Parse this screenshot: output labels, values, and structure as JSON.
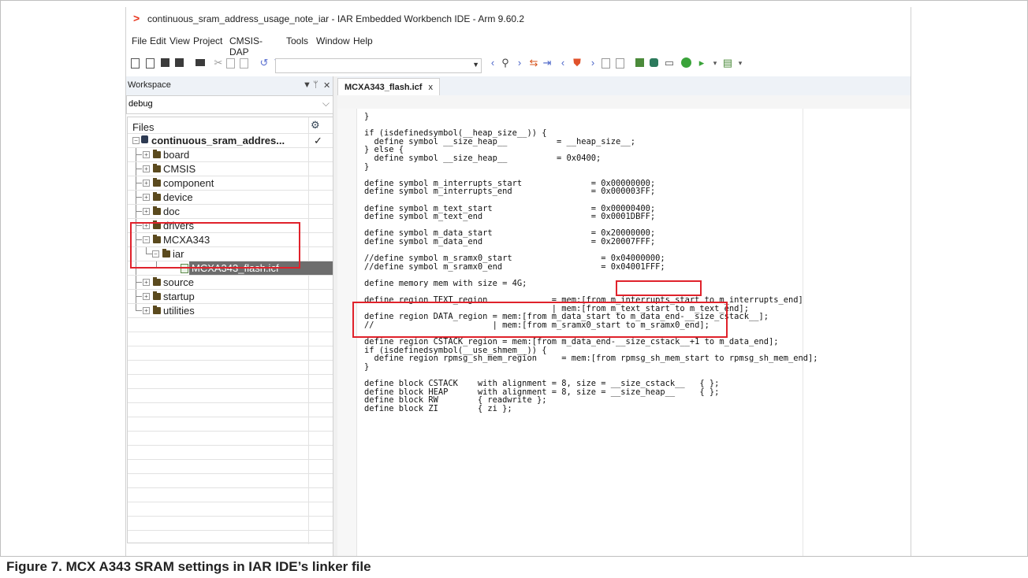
{
  "window": {
    "title": "continuous_sram_address_usage_note_iar - IAR Embedded Workbench IDE - Arm 9.60.2",
    "logo_glyph": ">"
  },
  "menu": [
    "File",
    "Edit",
    "View",
    "Project",
    "CMSIS-DAP",
    "Tools",
    "Window",
    "Help"
  ],
  "workspace": {
    "title": "Workspace",
    "controls": [
      "▼",
      "ᛘ",
      "✕"
    ],
    "configuration": "debug",
    "files_header": "Files",
    "settings_glyph": "⚙",
    "tree": [
      {
        "label": "continuous_sram_addres...",
        "kind": "project",
        "check": "✓"
      },
      {
        "label": "board",
        "kind": "folder"
      },
      {
        "label": "CMSIS",
        "kind": "folder"
      },
      {
        "label": "component",
        "kind": "folder"
      },
      {
        "label": "device",
        "kind": "folder"
      },
      {
        "label": "doc",
        "kind": "folder"
      },
      {
        "label": "drivers",
        "kind": "folder"
      },
      {
        "label": "MCXA343",
        "kind": "folder"
      },
      {
        "label": "iar",
        "kind": "folder"
      },
      {
        "label": "MCXA343_flash.icf",
        "kind": "file",
        "selected": true
      },
      {
        "label": "source",
        "kind": "folder"
      },
      {
        "label": "startup",
        "kind": "folder"
      },
      {
        "label": "utilities",
        "kind": "folder"
      }
    ]
  },
  "editor": {
    "tab_label": "MCXA343_flash.icf",
    "tab_close": "x",
    "code": "}\n\nif (isdefinedsymbol(__heap_size__)) {\n  define symbol __size_heap__          = __heap_size__;\n} else {\n  define symbol __size_heap__          = 0x0400;\n}\n\ndefine symbol m_interrupts_start              = 0x00000000;\ndefine symbol m_interrupts_end                = 0x000003FF;\n\ndefine symbol m_text_start                    = 0x00000400;\ndefine symbol m_text_end                      = 0x0001DBFF;\n\ndefine symbol m_data_start                    = 0x20000000;\ndefine symbol m_data_end                      = 0x20007FFF;\n\n//define symbol m_sramx0_start                  = 0x04000000;\n//define symbol m_sramx0_end                    = 0x04001FFF;\n\ndefine memory mem with size = 4G;\n\ndefine region TEXT_region             = mem:[from m_interrupts_start to m_interrupts_end]\n                                      | mem:[from m_text_start to m_text_end];\ndefine region DATA_region = mem:[from m_data_start to m_data_end-__size_cstack__];\n//                        | mem:[from m_sramx0_start to m_sramx0_end];\n\ndefine region CSTACK_region = mem:[from m_data_end-__size_cstack__+1 to m_data_end];\nif (isdefinedsymbol(__use_shmem__)) {\n  define region rpmsg_sh_mem_region     = mem:[from rpmsg_sh_mem_start to rpmsg_sh_mem_end];\n}\n\ndefine block CSTACK    with alignment = 8, size = __size_cstack__   { };\ndefine block HEAP      with alignment = 8, size = __size_heap__     { };\ndefine block RW        { readwrite };\ndefine block ZI        { zi };"
  },
  "caption": "Figure 7.  MCX A343 SRAM settings in IAR IDE’s linker file",
  "colors": {
    "highlight_box": "#e0222b",
    "logo": "#e8341c",
    "folder": "#5b4a1e",
    "selected_row": "#6d6d6d"
  }
}
